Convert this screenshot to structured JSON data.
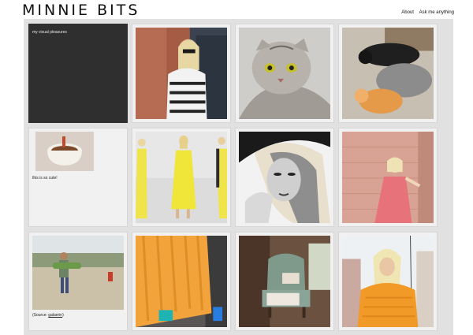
{
  "blog": {
    "title": "MINNIE BITS"
  },
  "nav": {
    "about": "About",
    "ask": "Ask me anything"
  },
  "posts": {
    "intro": "my visual pleasures",
    "cute": "this is so cute!",
    "source_prefix": "(Source: ",
    "source_name": "galaerin",
    "source_suffix": ")"
  }
}
